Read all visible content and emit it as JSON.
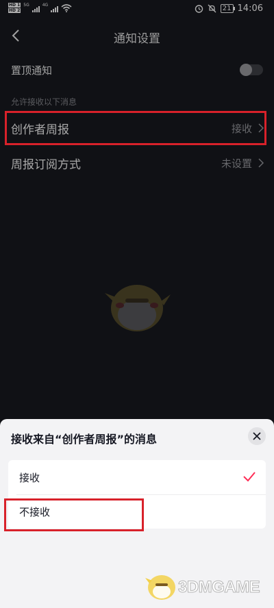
{
  "status_bar": {
    "sim1": "HD 1",
    "sim2": "HD 2",
    "net1": "5G",
    "net2": "4G",
    "battery": "21",
    "time": "14:06",
    "icons": [
      "alarm-icon",
      "mute-icon",
      "battery-icon",
      "wifi-icon",
      "signal-icon"
    ]
  },
  "header": {
    "title": "通知设置",
    "back_icon": "chevron-left-icon"
  },
  "settings": {
    "pin_label": "置顶通知",
    "pin_enabled": false,
    "section_label": "允许接收以下消息",
    "rows": [
      {
        "label": "创作者周报",
        "value": "接收"
      },
      {
        "label": "周报订阅方式",
        "value": "未设置"
      }
    ]
  },
  "sheet": {
    "title": "接收来自“创作者周报”的消息",
    "options": [
      {
        "label": "接收",
        "selected": true
      },
      {
        "label": "不接收",
        "selected": false
      }
    ]
  },
  "watermark": {
    "text": "3DMGAME"
  },
  "colors": {
    "background": "#16171c",
    "sheet_background": "#f3f3f5",
    "highlight_box": "#d8212a",
    "check_mark": "#fe2c55"
  }
}
